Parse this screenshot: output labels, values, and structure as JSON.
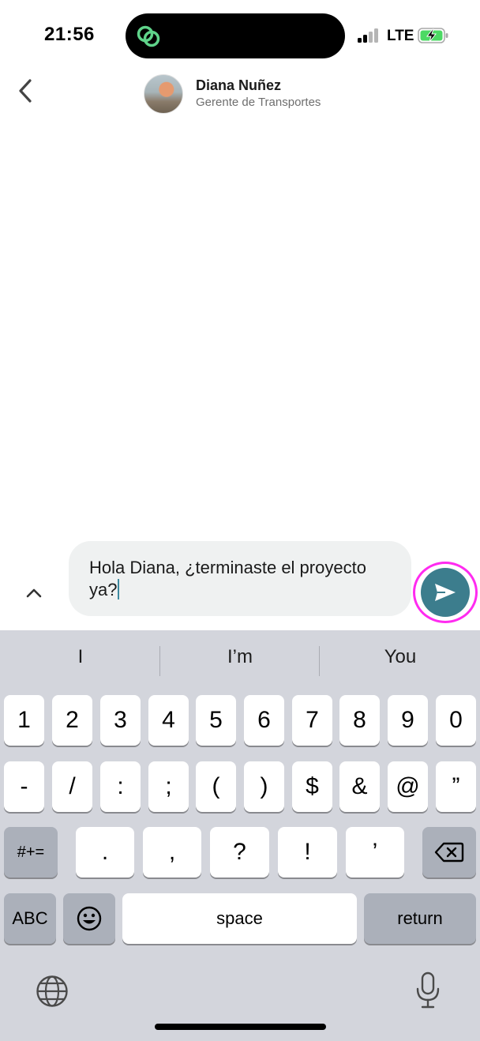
{
  "status_bar": {
    "time": "21:56",
    "network": "LTE"
  },
  "header": {
    "name": "Diana Nuñez",
    "role": "Gerente de Transportes"
  },
  "composer": {
    "message": "Hola Diana, ¿terminaste el proyecto ya?"
  },
  "keyboard": {
    "suggestions": [
      "I",
      "I’m",
      "You"
    ],
    "row1": [
      "1",
      "2",
      "3",
      "4",
      "5",
      "6",
      "7",
      "8",
      "9",
      "0"
    ],
    "row2": [
      "-",
      "/",
      ":",
      ";",
      "(",
      ")",
      "$",
      "&",
      "@",
      "”"
    ],
    "row3": {
      "mode": "#+=",
      "keys": [
        ".",
        ",",
        "?",
        "!",
        "’"
      ]
    },
    "row4": {
      "abc": "ABC",
      "space": "space",
      "return": "return"
    }
  },
  "colors": {
    "send_button": "#3c7d8d",
    "highlight_ring": "#ff2bf0",
    "island_icon": "#5fd38a"
  },
  "icons": [
    "back-chevron-icon",
    "app-link-icon",
    "signal-icon",
    "battery-charging-icon",
    "expand-chevron-icon",
    "send-icon",
    "delete-icon",
    "emoji-icon",
    "globe-icon",
    "mic-icon"
  ]
}
